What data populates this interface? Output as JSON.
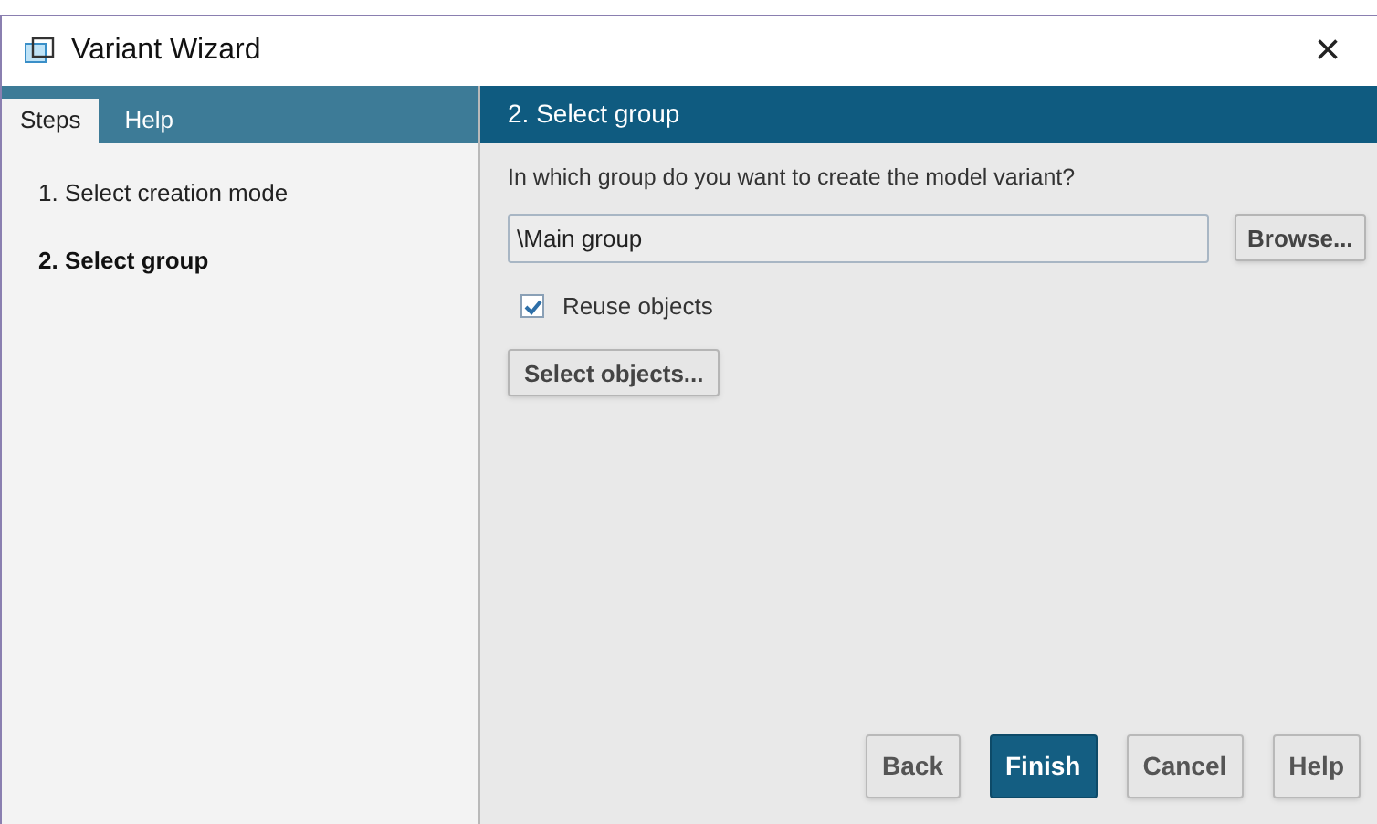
{
  "window": {
    "title": "Variant Wizard",
    "close": "×"
  },
  "tabs": [
    {
      "label": "Steps",
      "selected": true
    },
    {
      "label": "Help",
      "selected": false
    }
  ],
  "steps": [
    {
      "label": "1. Select creation mode",
      "selected": false
    },
    {
      "label": "2. Select group",
      "selected": true
    }
  ],
  "page": {
    "title": "2. Select group",
    "question": "In which group do you want to create the model variant?",
    "group_field": {
      "value": "\\Main group"
    },
    "browse_button": {
      "label": "Browse..."
    },
    "reuse": {
      "label": "Reuse objects",
      "checked": true
    },
    "select_objects_button": {
      "label": "Select objects..."
    }
  },
  "buttons": [
    {
      "label": "Back",
      "primary": false
    },
    {
      "label": "Finish",
      "primary": true
    },
    {
      "label": "Cancel",
      "primary": false
    },
    {
      "label": "Help",
      "primary": false
    }
  ]
}
